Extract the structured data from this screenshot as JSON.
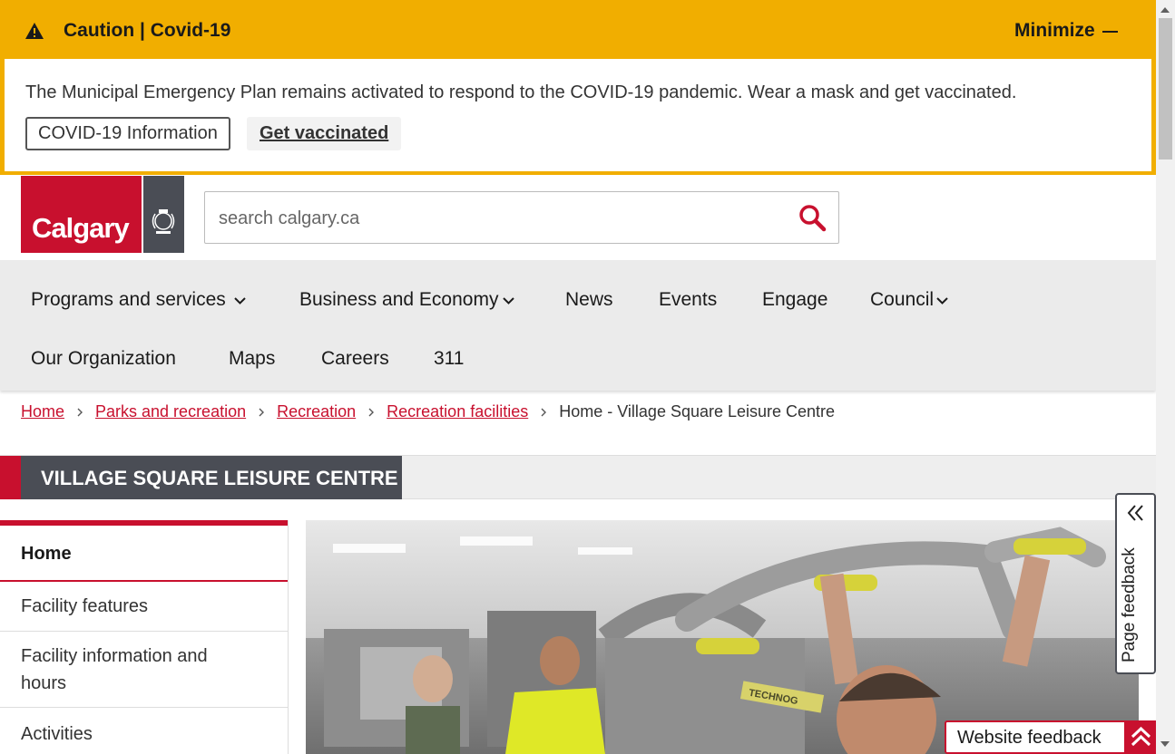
{
  "alert": {
    "title": "Caution | Covid-19",
    "minimize_label": "Minimize",
    "message": "The Municipal Emergency Plan remains activated to respond to the COVID-19 pandemic. Wear a mask and get vaccinated.",
    "covid_info_label": "COVID-19 Information",
    "get_vaccinated_label": "Get vaccinated",
    "color": "#f1ae00"
  },
  "header": {
    "logo_text": "Calgary",
    "search_placeholder": "search calgary.ca",
    "brand_color": "#c8102e"
  },
  "nav": {
    "items": [
      {
        "label": "Programs and services",
        "dropdown": true
      },
      {
        "label": "Business and Economy",
        "dropdown": true
      },
      {
        "label": "News",
        "dropdown": false
      },
      {
        "label": "Events",
        "dropdown": false
      },
      {
        "label": "Engage",
        "dropdown": false
      },
      {
        "label": "Council",
        "dropdown": true
      },
      {
        "label": "Our Organization",
        "dropdown": false
      },
      {
        "label": "Maps",
        "dropdown": false
      },
      {
        "label": "Careers",
        "dropdown": false
      },
      {
        "label": "311",
        "dropdown": false
      }
    ]
  },
  "breadcrumb": {
    "links": [
      "Home",
      "Parks and recreation",
      "Recreation",
      "Recreation facilities"
    ],
    "current": "Home - Village Square Leisure Centre"
  },
  "page": {
    "title": "VILLAGE SQUARE LEISURE CENTRE"
  },
  "sidenav": {
    "items": [
      "Home",
      "Facility features",
      "Facility information and hours",
      "Activities"
    ]
  },
  "hero": {
    "equipment_label": "TECHNOG"
  },
  "feedback": {
    "page_feedback_label": "Page feedback",
    "website_feedback_label": "Website feedback"
  }
}
